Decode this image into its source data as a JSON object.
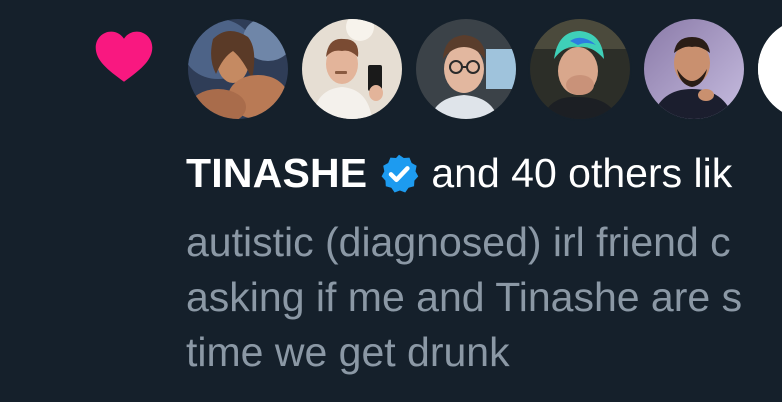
{
  "colors": {
    "background": "#15202b",
    "heart": "#f91880",
    "verified": "#1d9bf0",
    "name_text": "#ffffff",
    "muted_text": "#8b98a5"
  },
  "icons": {
    "like": "heart-icon",
    "verified": "verified-badge-icon"
  },
  "liked_by": {
    "name": "TINASHE",
    "rest": "and 40 others lik"
  },
  "tweet": {
    "lines": [
      "autistic (diagnosed) irl friend c",
      "asking if me and Tinashe are s",
      "time we get drunk"
    ]
  }
}
